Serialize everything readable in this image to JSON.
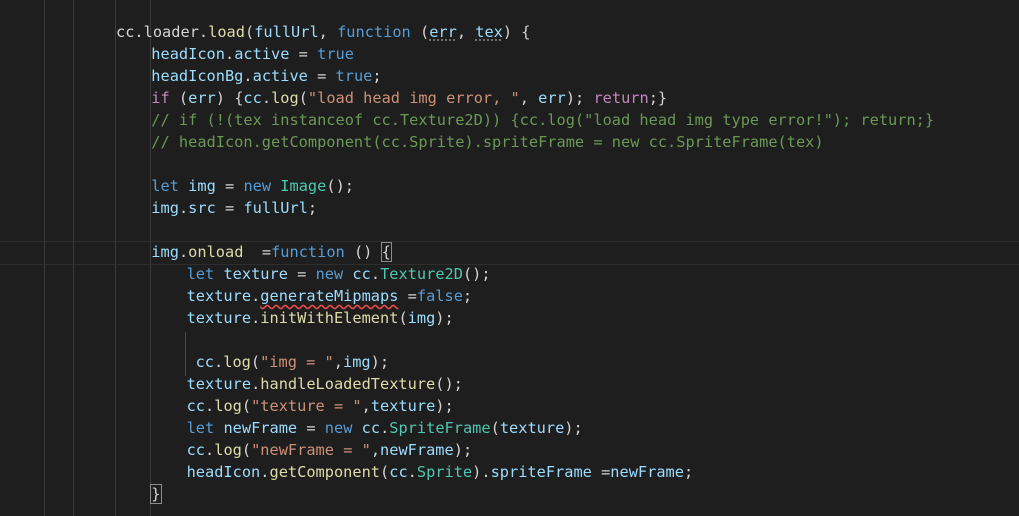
{
  "editor": {
    "theme_background": "#1e1e1e",
    "lines": [
      {
        "indent": 0,
        "tokens": [
          {
            "t": "cc",
            "c": "p"
          },
          {
            "t": ".",
            "c": "p"
          },
          {
            "t": "loader",
            "c": "p"
          },
          {
            "t": ".",
            "c": "p"
          },
          {
            "t": "load",
            "c": "f"
          },
          {
            "t": "(",
            "c": "p"
          },
          {
            "t": "fullUrl",
            "c": "v"
          },
          {
            "t": ", ",
            "c": "p"
          },
          {
            "t": "function",
            "c": "k"
          },
          {
            "t": " (",
            "c": "p"
          },
          {
            "t": "err",
            "c": "v",
            "x": "dotted"
          },
          {
            "t": ", ",
            "c": "p"
          },
          {
            "t": "tex",
            "c": "v",
            "x": "dotted"
          },
          {
            "t": ") {",
            "c": "p"
          }
        ]
      },
      {
        "indent": 1,
        "tokens": [
          {
            "t": "headIcon",
            "c": "v"
          },
          {
            "t": ".",
            "c": "p"
          },
          {
            "t": "active",
            "c": "v"
          },
          {
            "t": " = ",
            "c": "p"
          },
          {
            "t": "true",
            "c": "k"
          }
        ]
      },
      {
        "indent": 1,
        "tokens": [
          {
            "t": "headIconBg",
            "c": "v"
          },
          {
            "t": ".",
            "c": "p"
          },
          {
            "t": "active",
            "c": "v"
          },
          {
            "t": " = ",
            "c": "p"
          },
          {
            "t": "true",
            "c": "k"
          },
          {
            "t": ";",
            "c": "p"
          }
        ]
      },
      {
        "indent": 1,
        "tokens": [
          {
            "t": "if",
            "c": "kw"
          },
          {
            "t": " (",
            "c": "p"
          },
          {
            "t": "err",
            "c": "v"
          },
          {
            "t": ") {",
            "c": "p"
          },
          {
            "t": "cc",
            "c": "v"
          },
          {
            "t": ".",
            "c": "p"
          },
          {
            "t": "log",
            "c": "f"
          },
          {
            "t": "(",
            "c": "p"
          },
          {
            "t": "\"load head img error, \"",
            "c": "s"
          },
          {
            "t": ", ",
            "c": "p"
          },
          {
            "t": "err",
            "c": "v"
          },
          {
            "t": "); ",
            "c": "p"
          },
          {
            "t": "return",
            "c": "kw"
          },
          {
            "t": ";}",
            "c": "p"
          }
        ]
      },
      {
        "indent": 1,
        "tokens": [
          {
            "t": "// if (!(tex instanceof cc.Texture2D)) {cc.log(\"load head img type error!\"); return;}",
            "c": "c"
          }
        ]
      },
      {
        "indent": 1,
        "tokens": [
          {
            "t": "// headIcon.getComponent(cc.Sprite).spriteFrame = new cc.SpriteFrame(tex)",
            "c": "c"
          }
        ]
      },
      {
        "indent": 0,
        "tokens": []
      },
      {
        "indent": 1,
        "tokens": [
          {
            "t": "let",
            "c": "k"
          },
          {
            "t": " ",
            "c": "p"
          },
          {
            "t": "img",
            "c": "v"
          },
          {
            "t": " = ",
            "c": "p"
          },
          {
            "t": "new",
            "c": "k"
          },
          {
            "t": " ",
            "c": "p"
          },
          {
            "t": "Image",
            "c": "t"
          },
          {
            "t": "();",
            "c": "p"
          }
        ]
      },
      {
        "indent": 1,
        "tokens": [
          {
            "t": "img",
            "c": "v"
          },
          {
            "t": ".",
            "c": "p"
          },
          {
            "t": "src",
            "c": "v"
          },
          {
            "t": " = ",
            "c": "p"
          },
          {
            "t": "fullUrl",
            "c": "v"
          },
          {
            "t": ";",
            "c": "p"
          }
        ]
      },
      {
        "indent": 0,
        "tokens": []
      },
      {
        "indent": 1,
        "tokens": [
          {
            "t": "img",
            "c": "v"
          },
          {
            "t": ".",
            "c": "p"
          },
          {
            "t": "onload",
            "c": "f"
          },
          {
            "t": "  =",
            "c": "p"
          },
          {
            "t": "function",
            "c": "k"
          },
          {
            "t": " () ",
            "c": "p"
          },
          {
            "t": "{",
            "c": "p",
            "x": "box"
          }
        ]
      },
      {
        "indent": 2,
        "tokens": [
          {
            "t": "let",
            "c": "k"
          },
          {
            "t": " ",
            "c": "p"
          },
          {
            "t": "texture",
            "c": "v"
          },
          {
            "t": " = ",
            "c": "p"
          },
          {
            "t": "new",
            "c": "k"
          },
          {
            "t": " ",
            "c": "p"
          },
          {
            "t": "cc",
            "c": "v"
          },
          {
            "t": ".",
            "c": "p"
          },
          {
            "t": "Texture2D",
            "c": "t"
          },
          {
            "t": "();",
            "c": "p"
          }
        ]
      },
      {
        "indent": 2,
        "tokens": [
          {
            "t": "texture",
            "c": "v"
          },
          {
            "t": ".",
            "c": "p"
          },
          {
            "t": "generateMipmaps",
            "c": "v",
            "x": "squig"
          },
          {
            "t": " =",
            "c": "p"
          },
          {
            "t": "false",
            "c": "k"
          },
          {
            "t": ";",
            "c": "p"
          }
        ]
      },
      {
        "indent": 2,
        "tokens": [
          {
            "t": "texture",
            "c": "v"
          },
          {
            "t": ".",
            "c": "p"
          },
          {
            "t": "initWithElement",
            "c": "f"
          },
          {
            "t": "(",
            "c": "p"
          },
          {
            "t": "img",
            "c": "v"
          },
          {
            "t": ");",
            "c": "p"
          }
        ]
      },
      {
        "indent": 0,
        "tokens": []
      },
      {
        "indent": 2,
        "pad": 1,
        "tokens": [
          {
            "t": "cc",
            "c": "v"
          },
          {
            "t": ".",
            "c": "p"
          },
          {
            "t": "log",
            "c": "f"
          },
          {
            "t": "(",
            "c": "p"
          },
          {
            "t": "\"img = \"",
            "c": "s"
          },
          {
            "t": ",",
            "c": "p"
          },
          {
            "t": "img",
            "c": "v"
          },
          {
            "t": ");",
            "c": "p"
          }
        ]
      },
      {
        "indent": 2,
        "tokens": [
          {
            "t": "texture",
            "c": "v"
          },
          {
            "t": ".",
            "c": "p"
          },
          {
            "t": "handleLoadedTexture",
            "c": "f"
          },
          {
            "t": "();",
            "c": "p"
          }
        ]
      },
      {
        "indent": 2,
        "tokens": [
          {
            "t": "cc",
            "c": "v"
          },
          {
            "t": ".",
            "c": "p"
          },
          {
            "t": "log",
            "c": "f"
          },
          {
            "t": "(",
            "c": "p"
          },
          {
            "t": "\"texture = \"",
            "c": "s"
          },
          {
            "t": ",",
            "c": "p"
          },
          {
            "t": "texture",
            "c": "v"
          },
          {
            "t": ");",
            "c": "p"
          }
        ]
      },
      {
        "indent": 2,
        "tokens": [
          {
            "t": "let",
            "c": "k"
          },
          {
            "t": " ",
            "c": "p"
          },
          {
            "t": "newFrame",
            "c": "v"
          },
          {
            "t": " = ",
            "c": "p"
          },
          {
            "t": "new",
            "c": "k"
          },
          {
            "t": " ",
            "c": "p"
          },
          {
            "t": "cc",
            "c": "v"
          },
          {
            "t": ".",
            "c": "p"
          },
          {
            "t": "SpriteFrame",
            "c": "t"
          },
          {
            "t": "(",
            "c": "p"
          },
          {
            "t": "texture",
            "c": "v"
          },
          {
            "t": ");",
            "c": "p"
          }
        ]
      },
      {
        "indent": 2,
        "tokens": [
          {
            "t": "cc",
            "c": "v"
          },
          {
            "t": ".",
            "c": "p"
          },
          {
            "t": "log",
            "c": "f"
          },
          {
            "t": "(",
            "c": "p"
          },
          {
            "t": "\"newFrame = \"",
            "c": "s"
          },
          {
            "t": ",",
            "c": "p"
          },
          {
            "t": "newFrame",
            "c": "v"
          },
          {
            "t": ");",
            "c": "p"
          }
        ]
      },
      {
        "indent": 2,
        "tokens": [
          {
            "t": "headIcon",
            "c": "v"
          },
          {
            "t": ".",
            "c": "p"
          },
          {
            "t": "getComponent",
            "c": "f"
          },
          {
            "t": "(",
            "c": "p"
          },
          {
            "t": "cc",
            "c": "v"
          },
          {
            "t": ".",
            "c": "p"
          },
          {
            "t": "Sprite",
            "c": "t"
          },
          {
            "t": ").",
            "c": "p"
          },
          {
            "t": "spriteFrame",
            "c": "v"
          },
          {
            "t": " =",
            "c": "p"
          },
          {
            "t": "newFrame",
            "c": "v"
          },
          {
            "t": ";",
            "c": "p"
          }
        ]
      },
      {
        "indent": 1,
        "tokens": [
          {
            "t": "}",
            "c": "p",
            "x": "box"
          }
        ]
      }
    ]
  }
}
